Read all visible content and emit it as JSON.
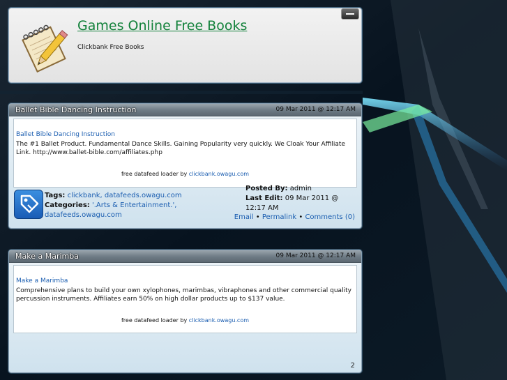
{
  "header": {
    "title": "Games Online Free Books",
    "subtitle": "Clickbank Free Books"
  },
  "posts": [
    {
      "title": "Ballet Bible Dancing Instruction",
      "date": "09 Mar 2011 @ 12:17 AM",
      "link_text": "Ballet Bible Dancing Instruction",
      "description": "The #1 Ballet Product. Fundamental Dance Skills. Gaining Popularity very quickly. We Cloak Your Affiliate Link. http://www.ballet-bible.com/affiliates.php",
      "loader_prefix": "free datafeed loader by",
      "loader_link": "clickbank.owagu.com",
      "tags_label": "Tags:",
      "tags_value": "clickbank, datafeeds.owagu.com",
      "categories_label": "Categories:",
      "categories_value": "'.Arts & Entertainment.', datafeeds.owagu.com",
      "posted_by_label": "Posted By:",
      "posted_by_value": "admin",
      "last_edit_label": "Last Edit:",
      "last_edit_value": "09 Mar 2011 @ 12:17 AM",
      "email_link": "Email",
      "permalink_link": "Permalink",
      "comments_link": "Comments (0)",
      "separator": "•"
    },
    {
      "title": "Make a Marimba",
      "date": "09 Mar 2011 @ 12:17 AM",
      "link_text": "Make a Marimba",
      "description": "Comprehensive plans to build your own xylophones, marimbas, vibraphones and other commercial quality percussion instruments. Affiliates earn 50% on high dollar products up to $137 value.",
      "loader_prefix": "free datafeed loader by",
      "loader_link": "clickbank.owagu.com",
      "page_number": "2"
    }
  ],
  "icons": {
    "minimize": "minimize-icon",
    "logo": "notepad-pencil-icon",
    "tag": "tag-icon"
  },
  "colors": {
    "title_green": "#12813a",
    "link_blue": "#1a5db0",
    "background": "#061320"
  }
}
